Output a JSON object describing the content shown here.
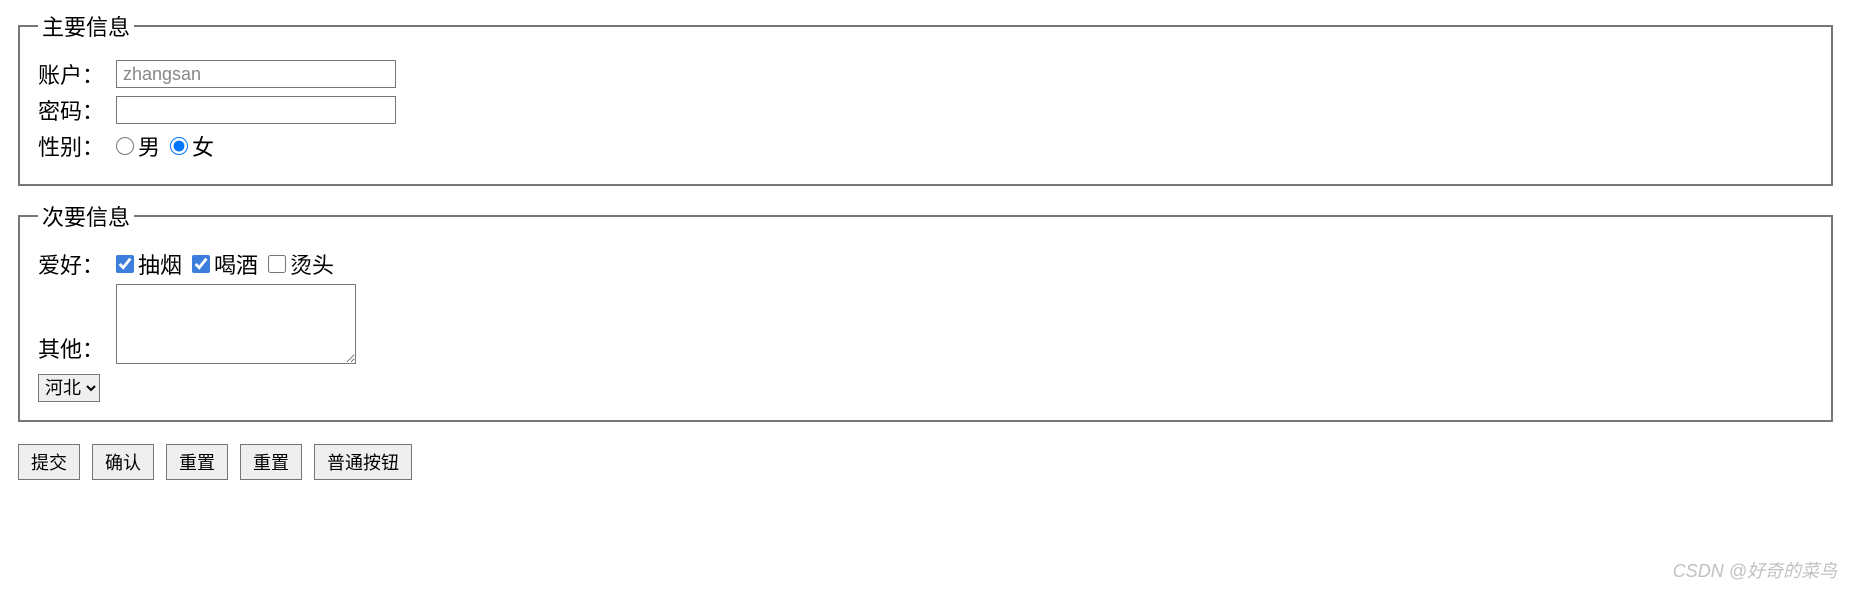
{
  "fieldset1": {
    "legend": "主要信息",
    "account": {
      "label": "账户：",
      "placeholder": "zhangsan",
      "value": ""
    },
    "password": {
      "label": "密码：",
      "value": ""
    },
    "gender": {
      "label": "性别：",
      "options": [
        {
          "label": "男",
          "checked": false
        },
        {
          "label": "女",
          "checked": true
        }
      ]
    }
  },
  "fieldset2": {
    "legend": "次要信息",
    "hobby": {
      "label": "爱好：",
      "options": [
        {
          "label": "抽烟",
          "checked": true
        },
        {
          "label": "喝酒",
          "checked": true
        },
        {
          "label": "烫头",
          "checked": false
        }
      ]
    },
    "other": {
      "label": "其他：",
      "value": ""
    },
    "province": {
      "selected": "河北",
      "options": [
        "河北"
      ]
    }
  },
  "buttons": {
    "submit": "提交",
    "confirm": "确认",
    "reset1": "重置",
    "reset2": "重置",
    "normal": "普通按钮"
  },
  "watermark": "CSDN @好奇的菜鸟"
}
